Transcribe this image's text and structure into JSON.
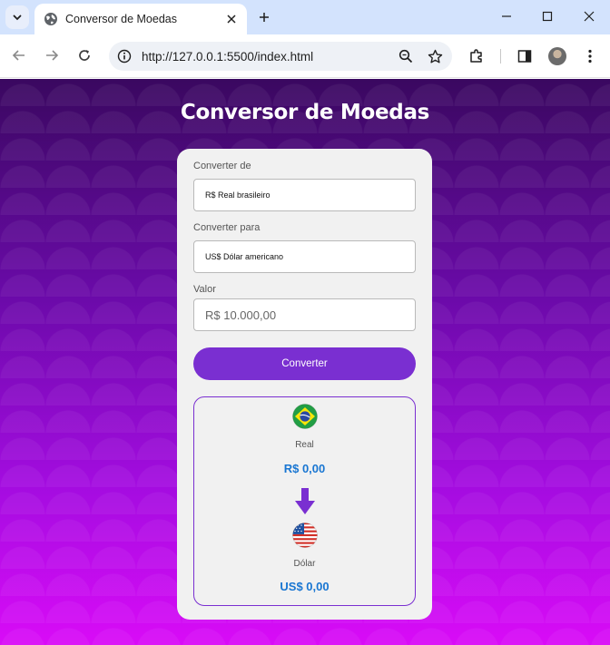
{
  "browser": {
    "tab_title": "Conversor de Moedas",
    "url": "http://127.0.0.1:5500/index.html"
  },
  "page": {
    "title": "Conversor de Moedas"
  },
  "form": {
    "from_label": "Converter de",
    "from_value": "R$ Real brasileiro",
    "to_label": "Converter para",
    "to_value": "US$ Dólar americano",
    "amount_label": "Valor",
    "amount_placeholder": "R$ 10.000,00",
    "convert_button": "Converter"
  },
  "result": {
    "from_currency_name": "Real",
    "from_currency_value": "R$ 0,00",
    "to_currency_name": "Dólar",
    "to_currency_value": "US$ 0,00"
  },
  "colors": {
    "accent": "#7a2fd1",
    "value_text": "#1976d2",
    "background_top": "#3a0860",
    "background_bottom": "#d90bf7"
  }
}
